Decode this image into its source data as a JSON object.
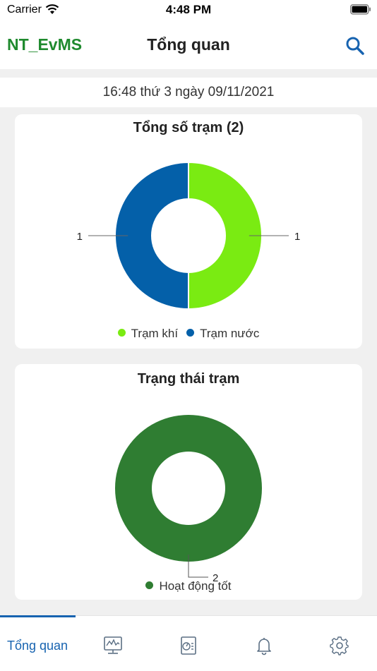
{
  "status_bar": {
    "carrier": "Carrier",
    "time": "4:48 PM"
  },
  "header": {
    "brand": "NT_EvMS",
    "title": "Tổng quan",
    "search_icon": "search-icon"
  },
  "datetime": "16:48 thứ 3 ngày 09/11/2021",
  "colors": {
    "brand": "#1f8a2e",
    "accent": "#1763b0",
    "khi": "#7aeb12",
    "nuoc": "#0460a9",
    "tot": "#2f7d32"
  },
  "chart_data": [
    {
      "type": "pie",
      "title": "Tổng số trạm (2)",
      "series": [
        {
          "name": "Trạm khí",
          "value": 1,
          "color": "#7aeb12"
        },
        {
          "name": "Trạm nước",
          "value": 1,
          "color": "#0460a9"
        }
      ],
      "legend_position": "bottom"
    },
    {
      "type": "pie",
      "title": "Trạng thái trạm",
      "series": [
        {
          "name": "Hoạt động tốt",
          "value": 2,
          "color": "#2f7d32"
        }
      ],
      "legend_position": "bottom"
    }
  ],
  "tabs": [
    {
      "label": "Tổng quan",
      "icon": "overview-tab",
      "active": true
    },
    {
      "label": "",
      "icon": "monitor-icon"
    },
    {
      "label": "",
      "icon": "report-icon"
    },
    {
      "label": "",
      "icon": "bell-icon"
    },
    {
      "label": "",
      "icon": "gear-icon"
    }
  ]
}
